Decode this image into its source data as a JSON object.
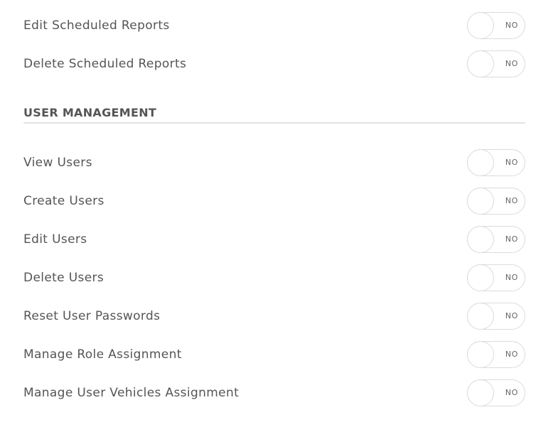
{
  "permissions_top": [
    {
      "label": "Edit Scheduled Reports",
      "state": "NO"
    },
    {
      "label": "Delete Scheduled Reports",
      "state": "NO"
    }
  ],
  "user_management": {
    "title": "USER MANAGEMENT",
    "items": [
      {
        "label": "View Users",
        "state": "NO"
      },
      {
        "label": "Create Users",
        "state": "NO"
      },
      {
        "label": "Edit Users",
        "state": "NO"
      },
      {
        "label": "Delete Users",
        "state": "NO"
      },
      {
        "label": "Reset User Passwords",
        "state": "NO"
      },
      {
        "label": "Manage Role Assignment",
        "state": "NO"
      },
      {
        "label": "Manage User Vehicles Assignment",
        "state": "NO"
      }
    ]
  }
}
